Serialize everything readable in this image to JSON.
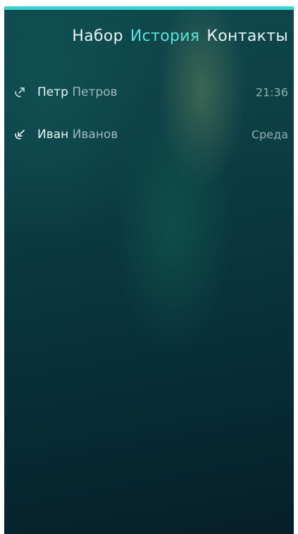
{
  "header": {
    "tabs": [
      {
        "label": "Набор"
      },
      {
        "label": "История"
      },
      {
        "label": "Контакты"
      }
    ],
    "active_tab": "История",
    "active_color": "#5ee2da"
  },
  "calls": [
    {
      "first_name": "Петр",
      "last_name": "Петров",
      "time": "21:36",
      "direction_icon": "outgoing-call-icon"
    },
    {
      "first_name": "Иван",
      "last_name": "Иванов",
      "time": "Среда",
      "direction_icon": "incoming-call-icon"
    }
  ],
  "colors": {
    "accent": "#35d6cf",
    "background_top": "#0f4a4e",
    "background_bottom": "#061f2a"
  }
}
